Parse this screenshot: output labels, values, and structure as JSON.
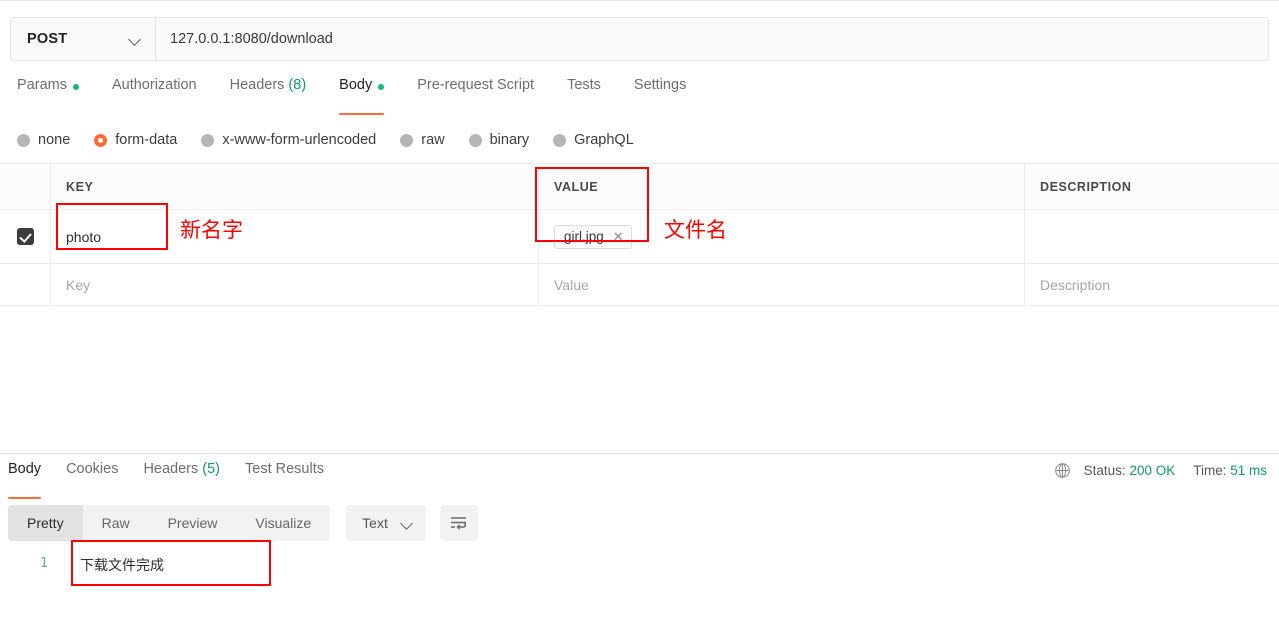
{
  "request": {
    "method": "POST",
    "method_caret_icon": "chevron-down-icon",
    "url": "127.0.0.1:8080/download",
    "tabs": [
      {
        "label": "Params",
        "dot": true,
        "count": "",
        "active": false
      },
      {
        "label": "Authorization",
        "dot": false,
        "count": "",
        "active": false
      },
      {
        "label": "Headers",
        "dot": false,
        "count": "(8)",
        "active": false
      },
      {
        "label": "Body",
        "dot": true,
        "count": "",
        "active": true
      },
      {
        "label": "Pre-request Script",
        "dot": false,
        "count": "",
        "active": false
      },
      {
        "label": "Tests",
        "dot": false,
        "count": "",
        "active": false
      },
      {
        "label": "Settings",
        "dot": false,
        "count": "",
        "active": false
      }
    ]
  },
  "body_types": [
    {
      "label": "none",
      "selected": false
    },
    {
      "label": "form-data",
      "selected": true
    },
    {
      "label": "x-www-form-urlencoded",
      "selected": false
    },
    {
      "label": "raw",
      "selected": false
    },
    {
      "label": "binary",
      "selected": false
    },
    {
      "label": "GraphQL",
      "selected": false
    }
  ],
  "form_table": {
    "headers": [
      "KEY",
      "VALUE",
      "DESCRIPTION"
    ],
    "rows": [
      {
        "checked": true,
        "key": "photo",
        "value_file": "girl.jpg",
        "value_remove_icon": "close-icon",
        "description": ""
      }
    ],
    "placeholder_row": {
      "key": "Key",
      "value": "Value",
      "description": "Description"
    }
  },
  "annotations": [
    {
      "text": "新名字",
      "color": "#ff0000"
    },
    {
      "text": "文件名",
      "color": "#ff0000"
    }
  ],
  "response": {
    "tabs": [
      {
        "label": "Body",
        "count": "",
        "active": true
      },
      {
        "label": "Cookies",
        "count": "",
        "active": false
      },
      {
        "label": "Headers",
        "count": "(5)",
        "active": false
      },
      {
        "label": "Test Results",
        "count": "",
        "active": false
      }
    ],
    "status": {
      "globe_icon": "globe-icon",
      "status_label": "Status:",
      "status_value": "200 OK",
      "time_label": "Time:",
      "time_value": "51 ms",
      "accent": "#0f9b6c"
    },
    "view_modes": [
      {
        "label": "Pretty",
        "active": true
      },
      {
        "label": "Raw",
        "active": false
      },
      {
        "label": "Preview",
        "active": false
      },
      {
        "label": "Visualize",
        "active": false
      }
    ],
    "format_select": {
      "value": "Text",
      "caret_icon": "chevron-down-icon"
    },
    "wrap_button_icon": "wrap-text-icon",
    "body_lines": [
      {
        "number": "1",
        "text": "下载文件完成"
      }
    ]
  },
  "colors": {
    "accent_orange": "#ff6c37",
    "green": "#10b981",
    "annotation_red": "#ff0000"
  }
}
